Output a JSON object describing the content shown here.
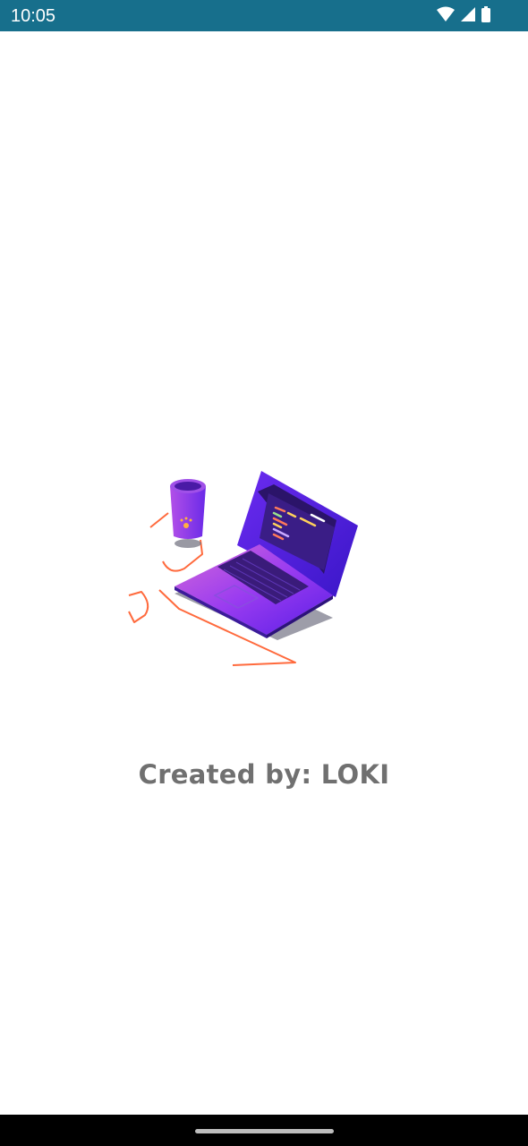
{
  "status_bar": {
    "time": "10:05",
    "background": "#176f8c",
    "icons": [
      "wifi-icon",
      "cellular-signal-icon",
      "battery-icon"
    ]
  },
  "splash": {
    "illustration": "laptop-and-cup-illustration",
    "credit_text": "Created by: LOKI",
    "credit_color": "#707070"
  },
  "nav_bar": {
    "background": "#000000",
    "handle": "home-gesture-handle"
  }
}
